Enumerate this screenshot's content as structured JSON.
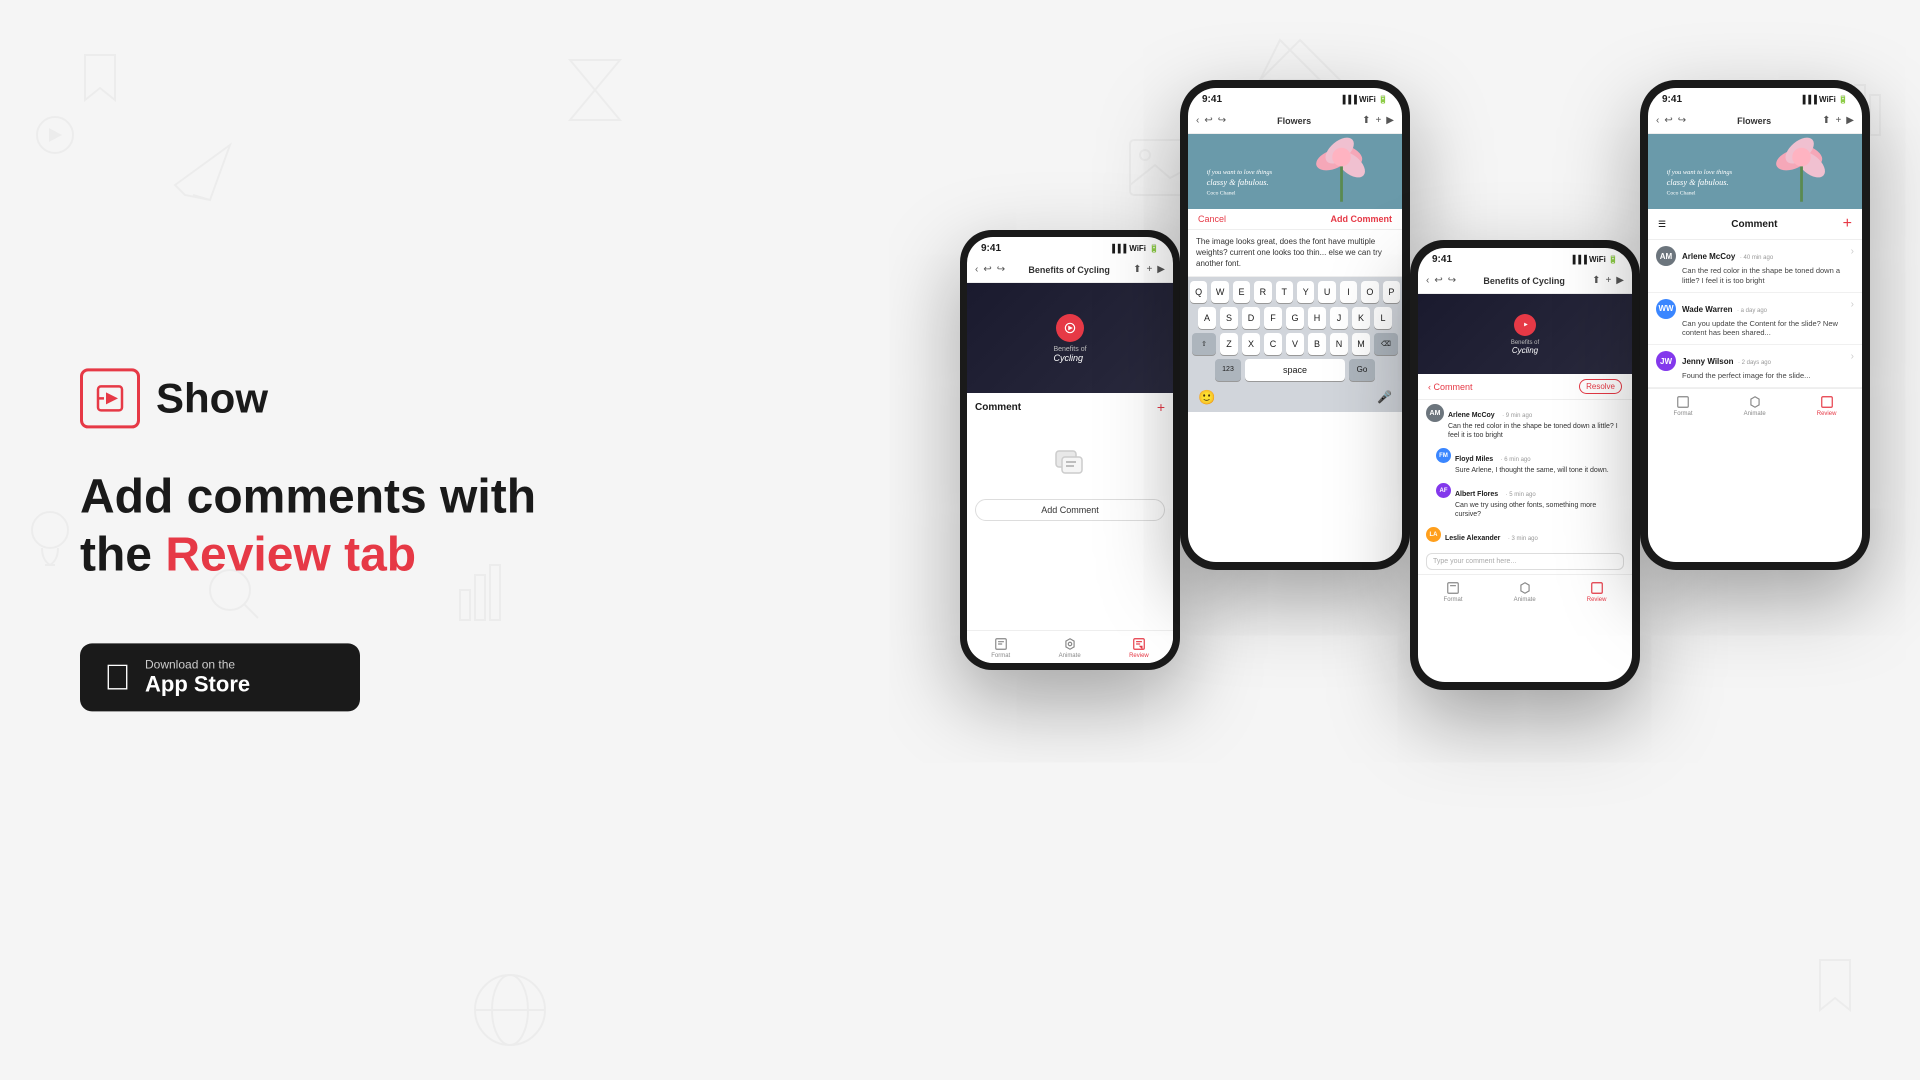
{
  "app": {
    "name": "Show",
    "tagline_line1": "Add comments with",
    "tagline_line2": "the ",
    "tagline_highlight": "Review tab",
    "app_store": {
      "label": "Download on the",
      "store": "App Store"
    }
  },
  "phone1": {
    "status_time": "9:41",
    "nav_title": "Benefits of Cycling",
    "slide_text_line1": "Benefits of",
    "slide_text_line2": "Cycling",
    "comment_title": "Comment",
    "add_comment_btn": "Add Comment",
    "tabs": [
      "Format",
      "Animate",
      "Review"
    ]
  },
  "phone2": {
    "status_time": "9:41",
    "nav_title": "Flowers",
    "cancel_label": "Cancel",
    "add_comment_label": "Add Comment",
    "input_text": "The image looks great, does the font have multiple weights? current one looks too thin... else we can try another font.",
    "keyboard_rows": [
      [
        "Q",
        "W",
        "E",
        "R",
        "T",
        "Y",
        "U",
        "I",
        "O",
        "P"
      ],
      [
        "A",
        "S",
        "D",
        "F",
        "G",
        "H",
        "J",
        "K",
        "L"
      ],
      [
        "Z",
        "X",
        "C",
        "V",
        "B",
        "N",
        "M"
      ]
    ]
  },
  "phone3": {
    "status_time": "9:41",
    "nav_title": "Benefits of Cycling",
    "slide_text_line1": "Benefits of",
    "slide_text_line2": "Cycling",
    "comment_header": "Comment",
    "resolve_btn": "Resolve",
    "comments": [
      {
        "author": "Arlene McCoy",
        "time": "9 min ago",
        "text": "Can the red color in the shape be toned down a little? I feel it is too bright",
        "avatar_color": "#6c757d",
        "initials": "AM"
      },
      {
        "author": "Floyd Miles",
        "time": "6 min ago",
        "text": "Sure Arlene, I thought the same, will tone it down.",
        "avatar_color": "#3a86ff",
        "initials": "FM"
      },
      {
        "author": "Albert Flores",
        "time": "5 min ago",
        "text": "Can we try using other fonts, something more cursive?",
        "avatar_color": "#8338ec",
        "initials": "AF"
      },
      {
        "author": "Leslie Alexander",
        "time": "3 min ago",
        "text": "",
        "avatar_color": "#ff9f1c",
        "initials": "LA"
      }
    ],
    "type_placeholder": "Type your comment here...",
    "tabs": [
      "Format",
      "Animate",
      "Review"
    ]
  },
  "phone4": {
    "status_time": "9:41",
    "nav_title": "Flowers",
    "comment_title": "Comment",
    "comments": [
      {
        "author": "Arlene McCoy",
        "time": "40 min ago",
        "text": "Can the red color in the shape be toned down a little? I feel it is too bright",
        "avatar_color": "#6c757d",
        "initials": "AM"
      },
      {
        "author": "Wade Warren",
        "time": "a day ago",
        "text": "Can you update the Content for the slide? New content has been shared...",
        "avatar_color": "#3a86ff",
        "initials": "WW"
      },
      {
        "author": "Jenny Wilson",
        "time": "2 days ago",
        "text": "Found the perfect image for the slide...",
        "avatar_color": "#8338ec",
        "initials": "JW"
      }
    ],
    "tabs": [
      "Format",
      "Animate",
      "Review"
    ]
  },
  "colors": {
    "accent": "#e63946",
    "dark": "#1a1a1a",
    "light_bg": "#f5f5f5"
  }
}
